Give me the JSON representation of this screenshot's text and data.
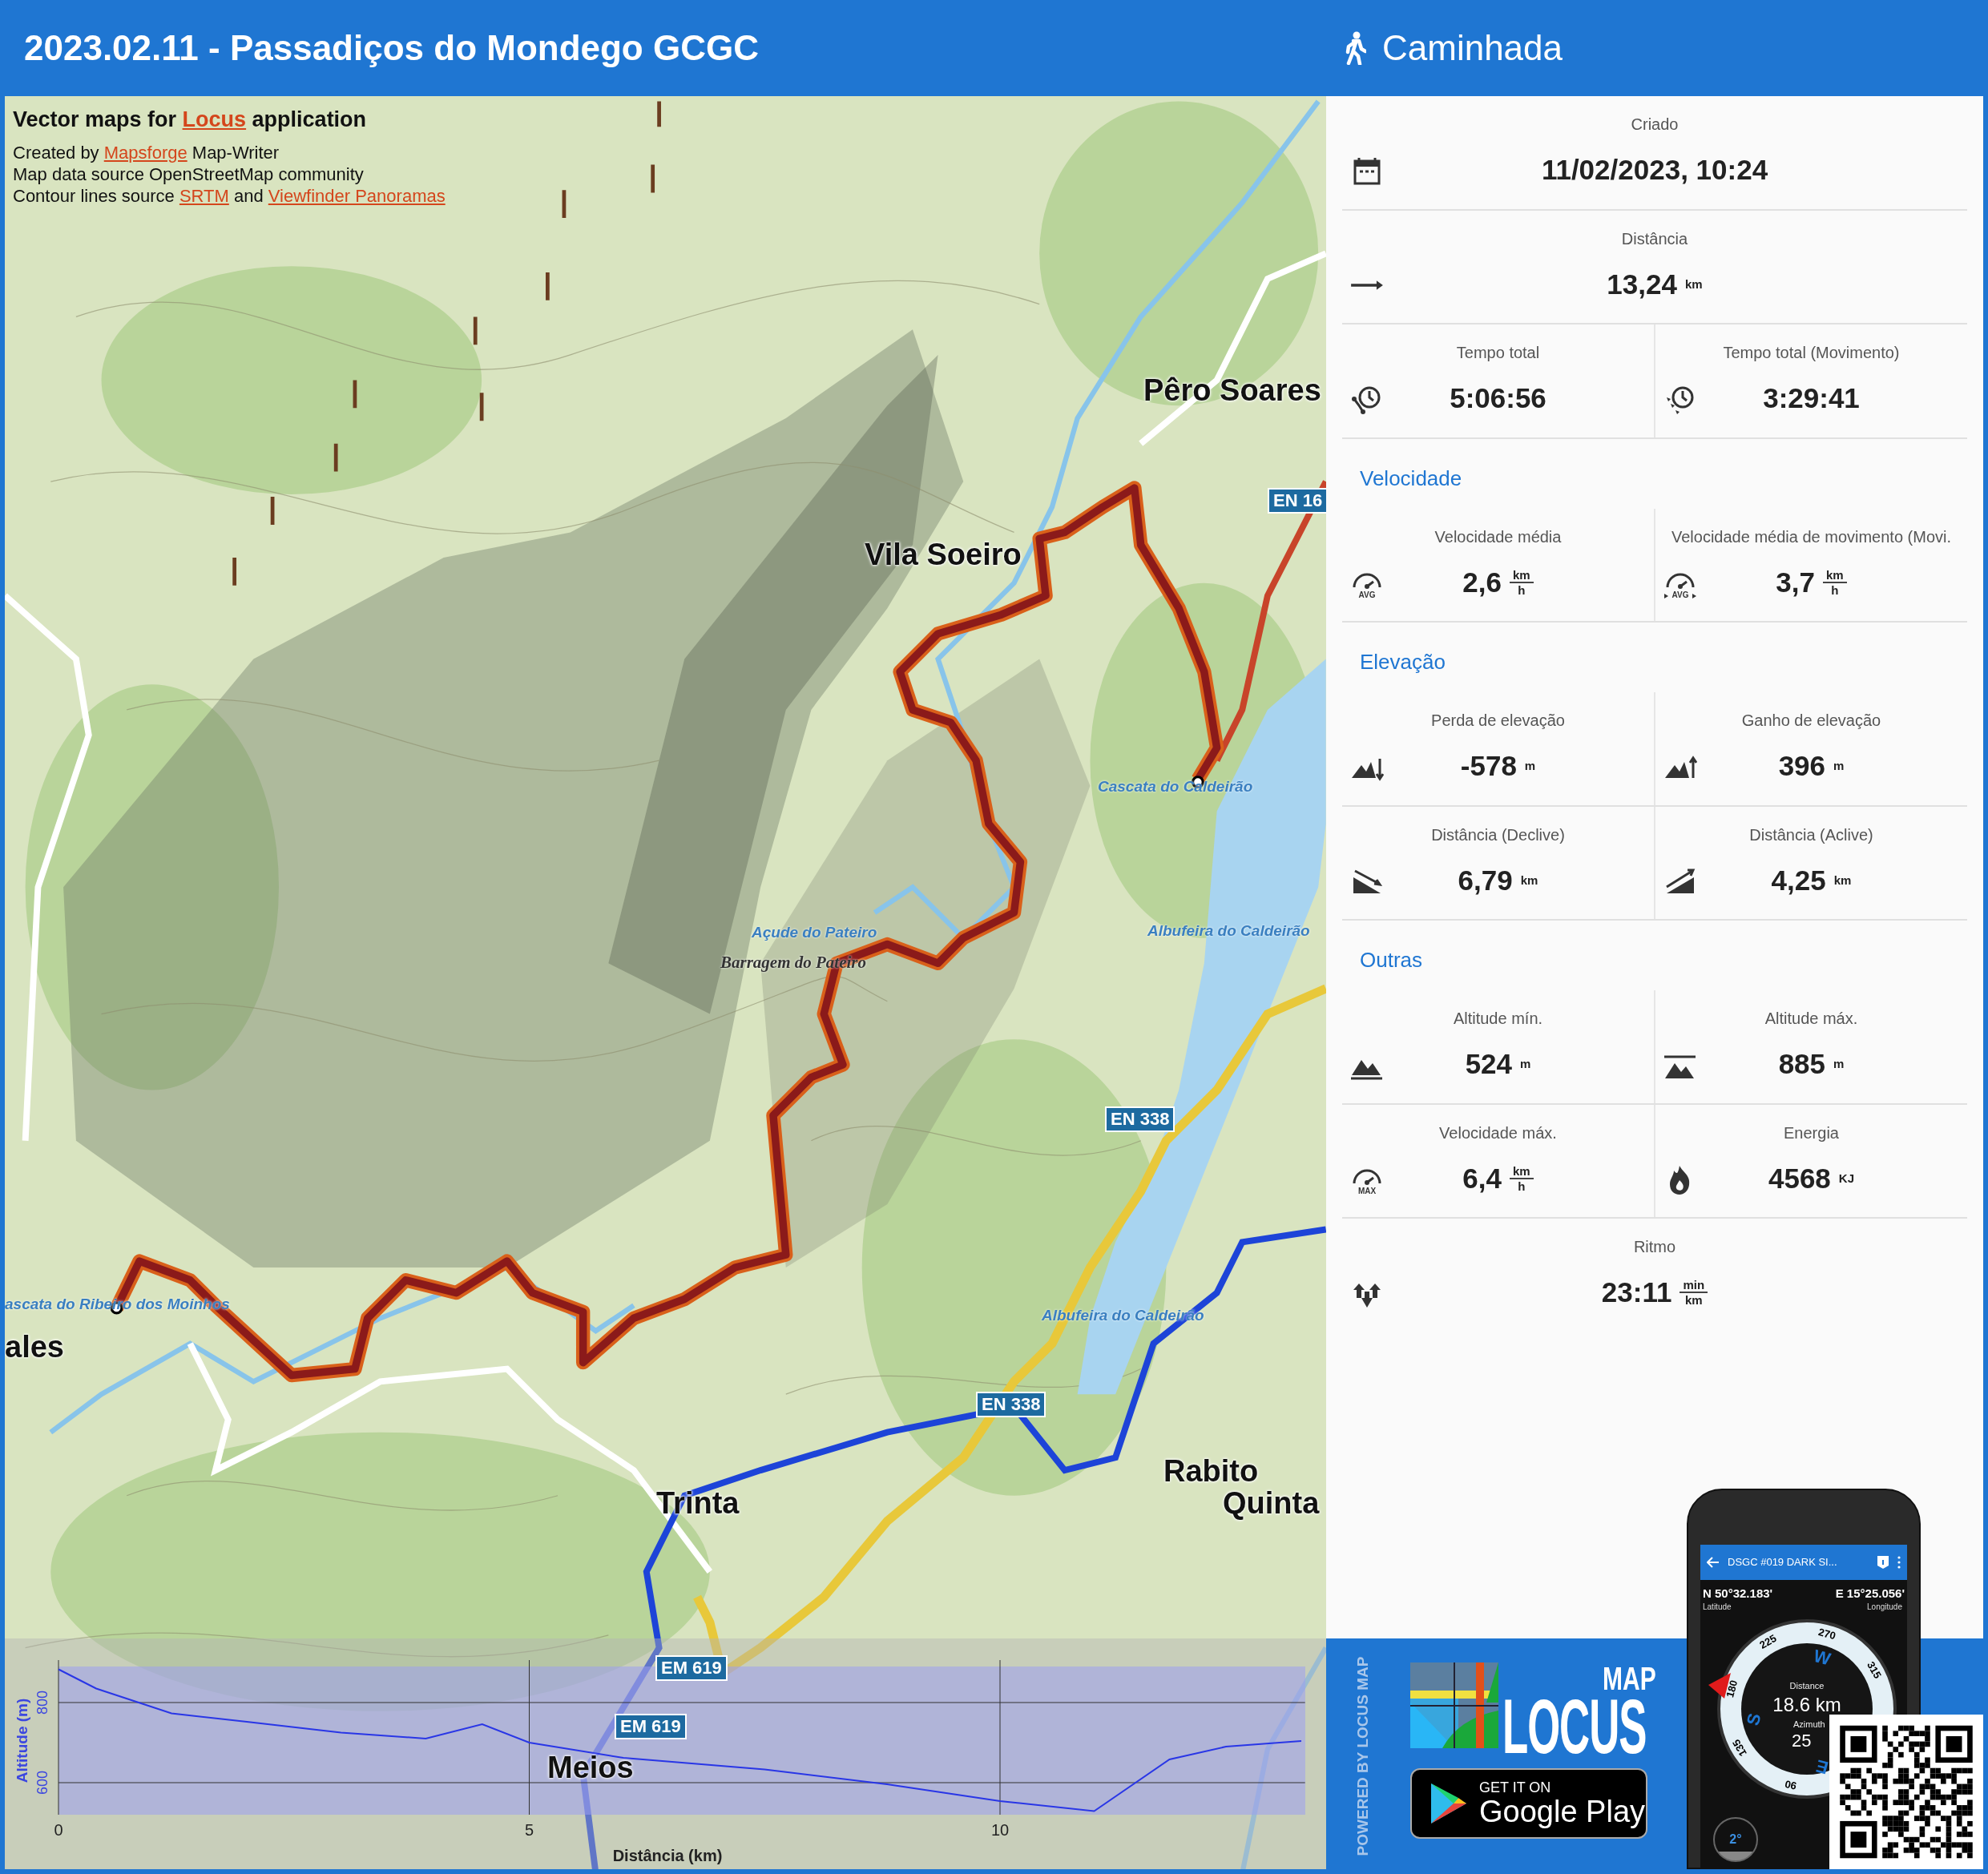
{
  "header": {
    "title": "2023.02.11 - Passadiços do Mondego GCGC",
    "activity": "Caminhada"
  },
  "map": {
    "attribution": [
      [
        {
          "text": "Vector maps for "
        },
        {
          "text": "Locus",
          "link": true
        },
        {
          "text": " application"
        }
      ],
      [
        {
          "text": "Created by "
        },
        {
          "text": "Mapsforge",
          "link": true
        },
        {
          "text": " Map-Writer"
        }
      ],
      [
        {
          "text": "Map data source OpenStreetMap community"
        }
      ],
      [
        {
          "text": "Contour lines source "
        },
        {
          "text": "SRTM",
          "link": true
        },
        {
          "text": " and "
        },
        {
          "text": "Viewfinder Panoramas",
          "link": true
        }
      ]
    ],
    "labels": [
      {
        "text": "Pêro Soares",
        "kind": "town"
      },
      {
        "text": "EN 16",
        "kind": "road"
      },
      {
        "text": "Vila Soeiro",
        "kind": "town"
      },
      {
        "text": "Cascata do Caldeirão",
        "kind": "water"
      },
      {
        "text": "Açude do Pateiro",
        "kind": "water"
      },
      {
        "text": "Barragem do Pateiro",
        "kind": "feature"
      },
      {
        "text": "Albufeira do Caldeirão",
        "kind": "water"
      },
      {
        "text": "EN 338",
        "kind": "road"
      },
      {
        "text": "ascata do Ribeiro dos Moinhos",
        "kind": "water"
      },
      {
        "text": "ales",
        "kind": "town"
      },
      {
        "text": "Albufeira do Caldeirão",
        "kind": "water"
      },
      {
        "text": "EN 338",
        "kind": "road"
      },
      {
        "text": "Rabito",
        "kind": "town"
      },
      {
        "text": "Trinta",
        "kind": "town"
      },
      {
        "text": "Quinta",
        "kind": "town"
      },
      {
        "text": "EM 619",
        "kind": "road"
      },
      {
        "text": "EM 619",
        "kind": "road"
      },
      {
        "text": "Meios",
        "kind": "town"
      }
    ],
    "chart_data": {
      "type": "line",
      "grid": true,
      "xlabel": "Distância (km)",
      "ylabel": "Altitude (m)",
      "x": [
        0,
        0.4,
        1.2,
        2,
        3,
        3.9,
        4.5,
        5,
        6,
        7.5,
        8.8,
        10,
        11,
        11.8,
        12.4,
        13.2
      ],
      "values": [
        883,
        835,
        773,
        752,
        725,
        710,
        746,
        700,
        662,
        633,
        596,
        554,
        529,
        658,
        690,
        704
      ],
      "xlim": [
        0,
        13.24
      ],
      "ylim": [
        520,
        890
      ],
      "xticks": [
        0,
        5,
        10
      ],
      "yticks": [
        600,
        800
      ]
    }
  },
  "stats": [
    {
      "rows": [
        [
          {
            "kind": "created",
            "label": "Criado",
            "value": "11/02/2023, 10:24"
          }
        ],
        [
          {
            "kind": "distance",
            "label": "Distância",
            "value": "13,24",
            "unit": "km"
          }
        ],
        [
          {
            "kind": "total-time",
            "label": "Tempo total",
            "value": "5:06:56"
          },
          {
            "kind": "moving-time",
            "label": "Tempo total (Movimento)",
            "value": "3:29:41"
          }
        ]
      ]
    },
    {
      "heading": "Velocidade",
      "rows": [
        [
          {
            "kind": "avg-speed",
            "icon_text": "AVG",
            "label": "Velocidade média",
            "value": "2,6",
            "unit_top": "km",
            "unit_bottom": "h"
          },
          {
            "kind": "moving-speed",
            "icon_text": "AVG",
            "label": "Velocidade média de movimento (Movi.",
            "value": "3,7",
            "unit_top": "km",
            "unit_bottom": "h"
          }
        ]
      ]
    },
    {
      "heading": "Elevação",
      "rows": [
        [
          {
            "kind": "descent",
            "label": "Perda de elevação",
            "value": "-578",
            "unit": "m"
          },
          {
            "kind": "ascent",
            "label": "Ganho de elevação",
            "value": "396",
            "unit": "m"
          }
        ],
        [
          {
            "kind": "downhill",
            "label": "Distância (Declive)",
            "value": "6,79",
            "unit": "km"
          },
          {
            "kind": "uphill",
            "label": "Distância (Aclive)",
            "value": "4,25",
            "unit": "km"
          }
        ]
      ]
    },
    {
      "heading": "Outras",
      "rows": [
        [
          {
            "kind": "min-altitude",
            "label": "Altitude mín.",
            "value": "524",
            "unit": "m"
          },
          {
            "kind": "max-altitude",
            "label": "Altitude máx.",
            "value": "885",
            "unit": "m"
          }
        ],
        [
          {
            "kind": "max-speed",
            "icon_text": "MAX",
            "label": "Velocidade máx.",
            "value": "6,4",
            "unit_top": "km",
            "unit_bottom": "h"
          },
          {
            "kind": "energy",
            "label": "Energia",
            "value": "4568",
            "unit": "KJ"
          }
        ],
        [
          {
            "kind": "pace",
            "label": "Ritmo",
            "value": "23:11",
            "unit_top": "min",
            "unit_bottom": "km"
          }
        ]
      ]
    }
  ],
  "promo": {
    "powered_by": "POWERED BY LOCUS MAP",
    "logo_small": "MAP",
    "logo_big": "LOCUS",
    "store_line1": "GET IT ON",
    "store_line2": "Google Play",
    "phone": {
      "title": "DSGC #019 DARK SI...",
      "lat": "N 50°32.183'",
      "lat_label": "Latitude",
      "lon": "E 15°25.056'",
      "lon_label": "Longitude",
      "ticks": [
        "225",
        "270",
        "315",
        "180",
        "135",
        "90"
      ],
      "cardinals": [
        "W",
        "S",
        "E"
      ],
      "distance_label": "Distance",
      "distance": "18.6 km",
      "azimuth_label": "Azimuth",
      "azimuth": "25",
      "tilt": "2°"
    }
  }
}
